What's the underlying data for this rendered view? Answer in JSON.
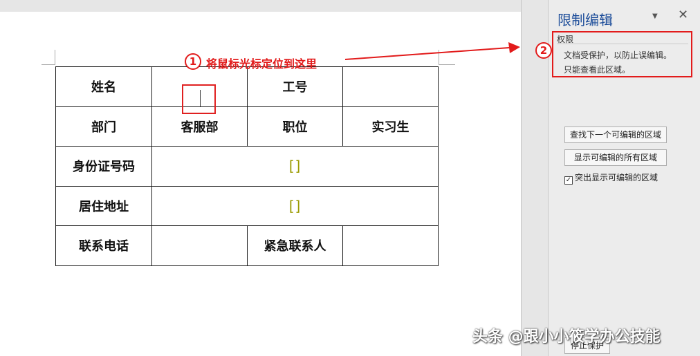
{
  "document": {
    "annotation_1": {
      "number": "1",
      "text": "将鼠标光标定位到这里"
    },
    "table": {
      "rows": [
        [
          "姓名",
          "",
          "工号",
          ""
        ],
        [
          "部门",
          "客服部",
          "职位",
          "实习生"
        ],
        [
          "身份证号码",
          "[]"
        ],
        [
          "居住地址",
          "[]"
        ],
        [
          "联系电话",
          "",
          "紧急联系人",
          ""
        ]
      ]
    }
  },
  "pane": {
    "title": "限制编辑",
    "dropdown_icon": "chevron-down-icon",
    "close_icon": "close-icon",
    "close_glyph": "✕",
    "dropdown_glyph": "▼",
    "annotation_2": {
      "number": "2"
    },
    "permissions": {
      "heading": "权限",
      "line1": "文档受保护，以防止误编辑。",
      "line2": "只能查看此区域。"
    },
    "find_next_button": "查找下一个可编辑的区域",
    "show_all_button": "显示可编辑的所有区域",
    "highlight_checkbox": {
      "label": "突出显示可编辑的区域",
      "checked": true,
      "mark": "✓"
    },
    "stop_protection_button": "停止保护"
  },
  "watermark": "头条 @跟小小筱学办公技能",
  "colors": {
    "accent_red": "#e21b1b",
    "title_blue": "#1e4e9a",
    "bracket_olive": "#9a9a00"
  }
}
